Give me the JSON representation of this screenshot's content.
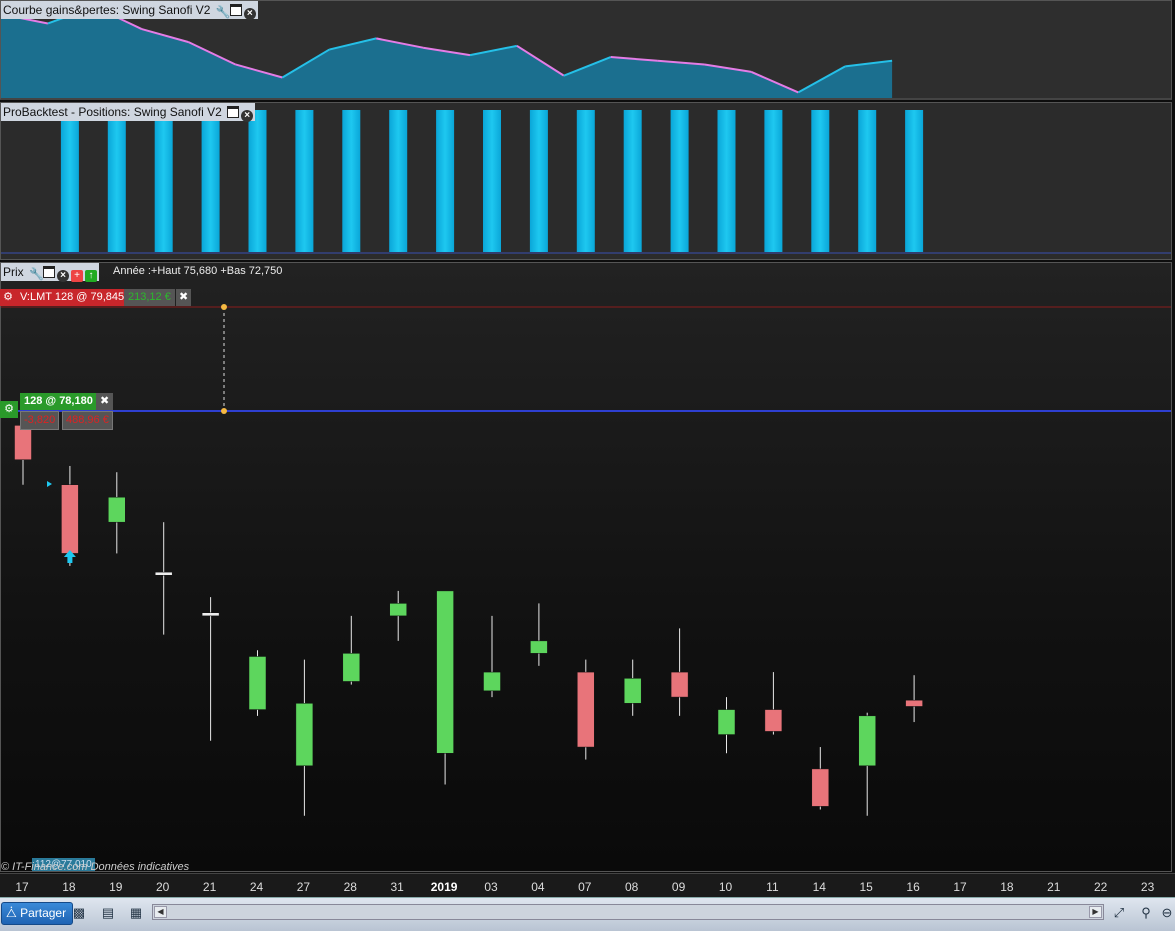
{
  "panels": {
    "equity": {
      "title": "Courbe gains&pertes: Swing Sanofi V2",
      "values": [
        96,
        95.5,
        96.4,
        95.2,
        94.5,
        93.3,
        92.6,
        94.1,
        94.7,
        94.2,
        93.8,
        94.3,
        92.7,
        93.7,
        93.5,
        93.3,
        92.9,
        91.8,
        93.2,
        93.5
      ]
    },
    "positions": {
      "title": "ProBacktest - Positions: Swing Sanofi V2",
      "bars": [
        1,
        1,
        1,
        1,
        1,
        1,
        1,
        1,
        1,
        1,
        1,
        1,
        1,
        1,
        1,
        1,
        1,
        1,
        1
      ]
    },
    "price": {
      "title": "Prix",
      "range_text": "Année :+Haut 75,680 +Bas 72,750"
    }
  },
  "orders": {
    "sell": {
      "label": "V:LMT  128 @ 79,845",
      "pnl": "213,12 €",
      "price": 79.845
    },
    "buy": {
      "label": "128 @ 78,180",
      "points": "-3,820",
      "pnl": "488,96 €",
      "price": 78.18
    },
    "old_order_label": "112@77,010"
  },
  "copyright": "© IT-Finance.com Données indicatives",
  "chart_data": {
    "type": "candlestick",
    "x_labels": [
      "17",
      "18",
      "19",
      "20",
      "21",
      "24",
      "27",
      "28",
      "31",
      "2019",
      "03",
      "04",
      "07",
      "08",
      "09",
      "10",
      "11",
      "14",
      "15",
      "16",
      "17",
      "18",
      "21",
      "22",
      "23"
    ],
    "year_label": "2019",
    "y_range": [
      71.0,
      80.0
    ],
    "candles": [
      {
        "o": 77.95,
        "h": 78.1,
        "l": 77.0,
        "c": 77.4
      },
      {
        "o": 77.0,
        "h": 77.3,
        "l": 75.7,
        "c": 75.9
      },
      {
        "o": 76.4,
        "h": 77.2,
        "l": 75.9,
        "c": 76.8
      },
      {
        "o": 75.6,
        "h": 76.4,
        "l": 74.6,
        "c": 75.55
      },
      {
        "o": 74.9,
        "h": 75.2,
        "l": 72.9,
        "c": 74.95
      },
      {
        "o": 73.4,
        "h": 74.35,
        "l": 73.3,
        "c": 74.25
      },
      {
        "o": 72.5,
        "h": 74.2,
        "l": 71.7,
        "c": 73.5
      },
      {
        "o": 73.85,
        "h": 74.9,
        "l": 73.8,
        "c": 74.3
      },
      {
        "o": 74.9,
        "h": 75.3,
        "l": 74.5,
        "c": 75.1
      },
      {
        "o": 72.7,
        "h": 75.1,
        "l": 72.2,
        "c": 75.3
      },
      {
        "o": 73.7,
        "h": 74.9,
        "l": 73.6,
        "c": 74.0
      },
      {
        "o": 74.3,
        "h": 75.1,
        "l": 74.1,
        "c": 74.5
      },
      {
        "o": 74.0,
        "h": 74.2,
        "l": 72.6,
        "c": 72.8
      },
      {
        "o": 73.5,
        "h": 74.2,
        "l": 73.3,
        "c": 73.9
      },
      {
        "o": 74.0,
        "h": 74.7,
        "l": 73.3,
        "c": 73.6
      },
      {
        "o": 73.0,
        "h": 73.6,
        "l": 72.7,
        "c": 73.4
      },
      {
        "o": 73.4,
        "h": 74.0,
        "l": 73.0,
        "c": 73.05
      },
      {
        "o": 72.45,
        "h": 72.8,
        "l": 71.8,
        "c": 71.85
      },
      {
        "o": 72.5,
        "h": 73.35,
        "l": 71.7,
        "c": 73.3
      },
      {
        "o": 73.55,
        "h": 73.95,
        "l": 73.2,
        "c": 73.45
      }
    ]
  },
  "bottom": {
    "share_label": "Partager",
    "icons": [
      "chart-type-icon",
      "list-icon",
      "table-icon"
    ]
  },
  "colors": {
    "up": "#5dd65d",
    "down": "#e8747a",
    "position": "#1ec8f0",
    "equity_fill": "#1b6f8f",
    "equity_line_up": "#25c0e8",
    "equity_line_down": "#e47ce6"
  }
}
